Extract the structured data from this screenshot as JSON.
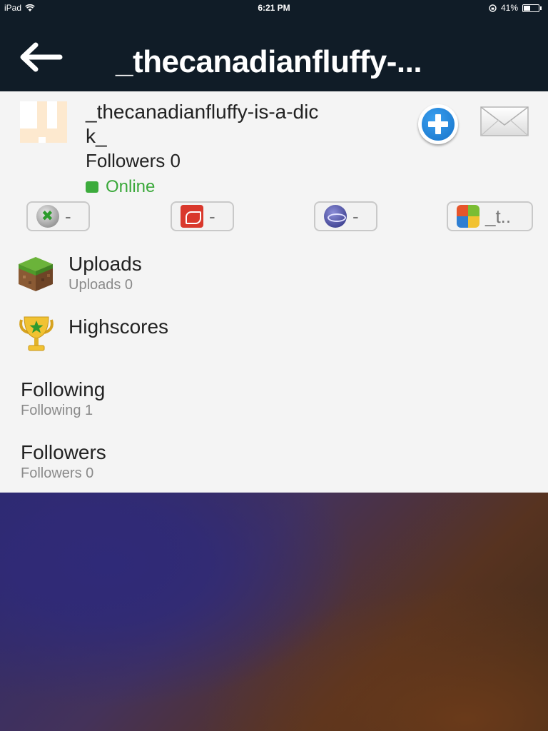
{
  "status_bar": {
    "device": "iPad",
    "time": "6:21 PM",
    "battery": "41%",
    "battery_level": 0.41
  },
  "nav": {
    "title": "_thecanadianfluffy-..."
  },
  "profile": {
    "username": "_thecanadianfluffy-is-a-dick_",
    "followers_text": "Followers 0",
    "status": "Online",
    "status_color": "#3cab3c"
  },
  "gamer_tags": [
    {
      "platform": "xbox-icon",
      "value": "-"
    },
    {
      "platform": "origin-icon",
      "value": "-"
    },
    {
      "platform": "playstation-icon",
      "value": "-"
    },
    {
      "platform": "game-center-icon",
      "value": "_t.."
    }
  ],
  "rows": {
    "uploads": {
      "title": "Uploads",
      "subtitle": "Uploads 0"
    },
    "highscores": {
      "title": "Highscores"
    },
    "following": {
      "title": "Following",
      "subtitle": "Following 1"
    },
    "followers": {
      "title": "Followers",
      "subtitle": "Followers 0"
    }
  },
  "colors": {
    "navbar": "#101c27",
    "accent_blue": "#1672c8",
    "online_green": "#3cab3c"
  }
}
